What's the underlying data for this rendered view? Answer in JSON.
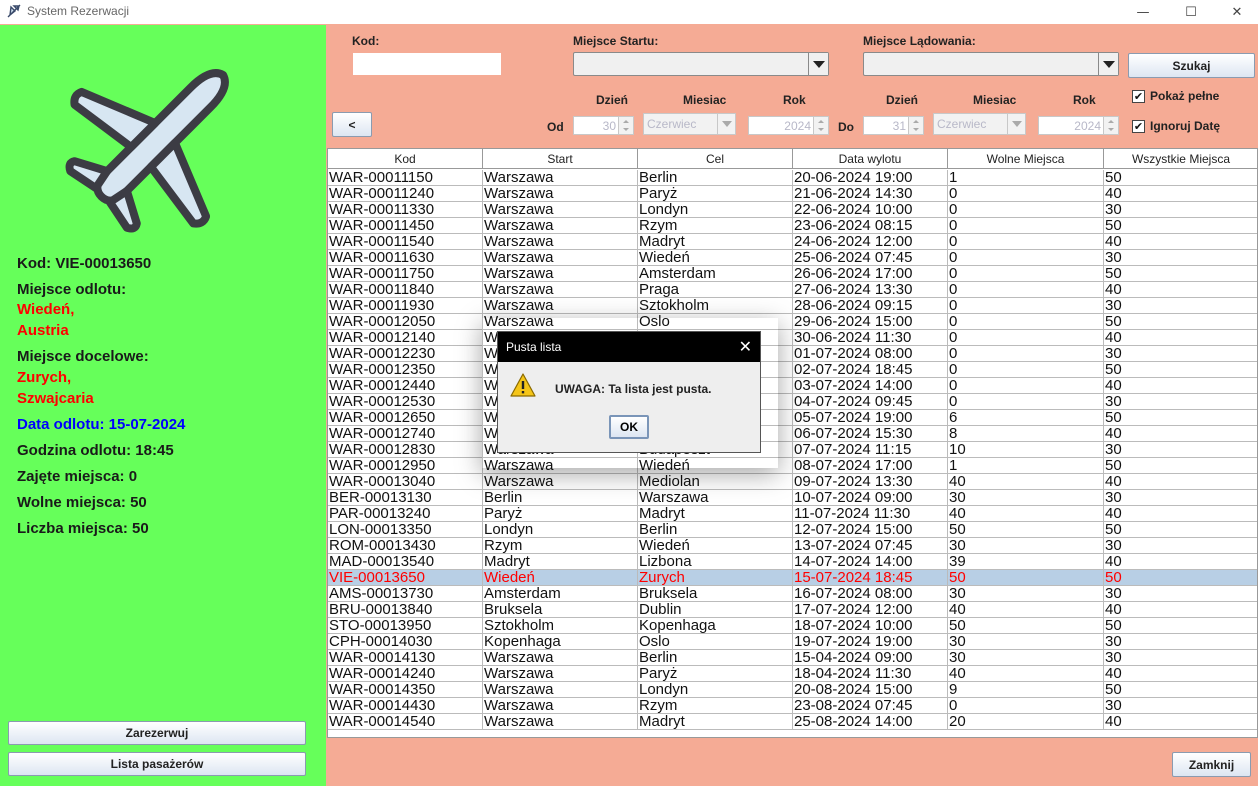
{
  "window": {
    "title": "System Rezerwacji"
  },
  "details": {
    "code": "Kod: VIE-00013650",
    "departure_label": "Miejsce odlotu:",
    "departure_city": "Wiedeń,",
    "departure_country": "Austria",
    "destination_label": "Miejsce docelowe:",
    "destination_city": "Zurych,",
    "destination_country": "Szwajcaria",
    "date": "Data odlotu: 15-07-2024",
    "time": "Godzina odlotu: 18:45",
    "taken": "Zajęte miejsca: 0",
    "free": "Wolne miejsca: 50",
    "total": "Liczba miejsca: 50"
  },
  "left_buttons": {
    "reserve": "Zarezerwuj",
    "passengers": "Lista pasażerów"
  },
  "filter": {
    "code_label": "Kod:",
    "code_value": "",
    "start_label": "Miejsce Startu:",
    "landing_label": "Miejsce Lądowania:",
    "search": "Szukaj",
    "back": "<",
    "from_label": "Od",
    "to_label": "Do",
    "day_label": "Dzień",
    "month_label": "Miesiac",
    "year_label": "Rok",
    "from_day": "30",
    "from_month": "Czerwiec",
    "from_year": "2024",
    "to_day": "31",
    "to_month": "Czerwiec",
    "to_year": "2024",
    "show_full": "Pokaż pełne",
    "ignore_date": "Ignoruj Datę",
    "show_full_checked": true,
    "ignore_date_checked": true
  },
  "table": {
    "columns": [
      "Kod",
      "Start",
      "Cel",
      "Data wylotu",
      "Wolne Miejsca",
      "Wszystkie Miejsca"
    ],
    "selected_index": 25,
    "rows": [
      [
        "WAR-00011150",
        "Warszawa",
        "Berlin",
        "20-06-2024 19:00",
        "1",
        "50"
      ],
      [
        "WAR-00011240",
        "Warszawa",
        "Paryż",
        "21-06-2024 14:30",
        "0",
        "40"
      ],
      [
        "WAR-00011330",
        "Warszawa",
        "Londyn",
        "22-06-2024 10:00",
        "0",
        "30"
      ],
      [
        "WAR-00011450",
        "Warszawa",
        "Rzym",
        "23-06-2024 08:15",
        "0",
        "50"
      ],
      [
        "WAR-00011540",
        "Warszawa",
        "Madryt",
        "24-06-2024 12:00",
        "0",
        "40"
      ],
      [
        "WAR-00011630",
        "Warszawa",
        "Wiedeń",
        "25-06-2024 07:45",
        "0",
        "30"
      ],
      [
        "WAR-00011750",
        "Warszawa",
        "Amsterdam",
        "26-06-2024 17:00",
        "0",
        "50"
      ],
      [
        "WAR-00011840",
        "Warszawa",
        "Praga",
        "27-06-2024 13:30",
        "0",
        "40"
      ],
      [
        "WAR-00011930",
        "Warszawa",
        "Sztokholm",
        "28-06-2024 09:15",
        "0",
        "30"
      ],
      [
        "WAR-00012050",
        "Warszawa",
        "Oslo",
        "29-06-2024 15:00",
        "0",
        "50"
      ],
      [
        "WAR-00012140",
        "Warszawa",
        "",
        "30-06-2024 11:30",
        "0",
        "40"
      ],
      [
        "WAR-00012230",
        "Warszawa",
        "",
        "01-07-2024 08:00",
        "0",
        "30"
      ],
      [
        "WAR-00012350",
        "Warszawa",
        "",
        "02-07-2024 18:45",
        "0",
        "50"
      ],
      [
        "WAR-00012440",
        "Warszawa",
        "",
        "03-07-2024 14:00",
        "0",
        "40"
      ],
      [
        "WAR-00012530",
        "Warszawa",
        "",
        "04-07-2024 09:45",
        "0",
        "30"
      ],
      [
        "WAR-00012650",
        "Warszawa",
        "",
        "05-07-2024 19:00",
        "6",
        "50"
      ],
      [
        "WAR-00012740",
        "Warszawa",
        "",
        "06-07-2024 15:30",
        "8",
        "40"
      ],
      [
        "WAR-00012830",
        "Warszawa",
        "Budapeszt",
        "07-07-2024 11:15",
        "10",
        "30"
      ],
      [
        "WAR-00012950",
        "Warszawa",
        "Wiedeń",
        "08-07-2024 17:00",
        "1",
        "50"
      ],
      [
        "WAR-00013040",
        "Warszawa",
        "Mediolan",
        "09-07-2024 13:30",
        "40",
        "40"
      ],
      [
        "BER-00013130",
        "Berlin",
        "Warszawa",
        "10-07-2024 09:00",
        "30",
        "30"
      ],
      [
        "PAR-00013240",
        "Paryż",
        "Madryt",
        "11-07-2024 11:30",
        "40",
        "40"
      ],
      [
        "LON-00013350",
        "Londyn",
        "Berlin",
        "12-07-2024 15:00",
        "50",
        "50"
      ],
      [
        "ROM-00013430",
        "Rzym",
        "Wiedeń",
        "13-07-2024 07:45",
        "30",
        "30"
      ],
      [
        "MAD-00013540",
        "Madryt",
        "Lizbona",
        "14-07-2024 14:00",
        "39",
        "40"
      ],
      [
        "VIE-00013650",
        "Wiedeń",
        "Zurych",
        "15-07-2024 18:45",
        "50",
        "50"
      ],
      [
        "AMS-00013730",
        "Amsterdam",
        "Bruksela",
        "16-07-2024 08:00",
        "30",
        "30"
      ],
      [
        "BRU-00013840",
        "Bruksela",
        "Dublin",
        "17-07-2024 12:00",
        "40",
        "40"
      ],
      [
        "STO-00013950",
        "Sztokholm",
        "Kopenhaga",
        "18-07-2024 10:00",
        "50",
        "50"
      ],
      [
        "CPH-00014030",
        "Kopenhaga",
        "Oslo",
        "19-07-2024 19:00",
        "30",
        "30"
      ],
      [
        "WAR-00014130",
        "Warszawa",
        "Berlin",
        "15-04-2024 09:00",
        "30",
        "30"
      ],
      [
        "WAR-00014240",
        "Warszawa",
        "Paryż",
        "18-04-2024 11:30",
        "40",
        "40"
      ],
      [
        "WAR-00014350",
        "Warszawa",
        "Londyn",
        "20-08-2024 15:00",
        "9",
        "50"
      ],
      [
        "WAR-00014430",
        "Warszawa",
        "Rzym",
        "23-08-2024 07:45",
        "0",
        "30"
      ],
      [
        "WAR-00014540",
        "Warszawa",
        "Madryt",
        "25-08-2024 14:00",
        "20",
        "40"
      ]
    ]
  },
  "close_button": "Zamknij",
  "dialog": {
    "title": "Pusta lista",
    "message": "UWAGA: Ta lista jest pusta.",
    "ok": "OK"
  },
  "colors": {
    "left_panel": "#66ff5a",
    "main_panel": "#f5ab95",
    "highlight": "#ff0000",
    "date": "#0000ff",
    "selection": "#b8cfe5"
  }
}
